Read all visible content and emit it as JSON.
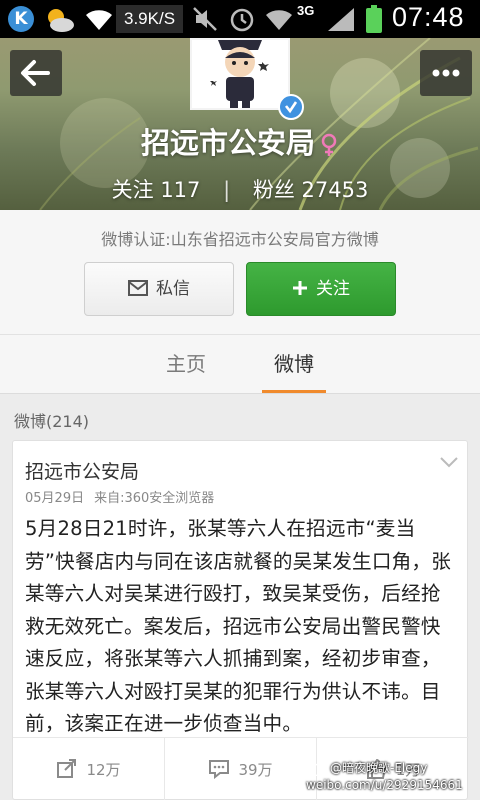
{
  "status_bar": {
    "net_speed": "3.9K/S",
    "network_type": "3G",
    "time": "07:48",
    "icons": [
      "k-app-icon",
      "weather-icon",
      "wifi-icon",
      "mute-icon",
      "alarm-icon",
      "wifi-icon",
      "signal-icon",
      "battery-icon"
    ]
  },
  "profile": {
    "name": "招远市公安局",
    "follow_label": "关注",
    "follow_count": "117",
    "fans_label": "粉丝",
    "fans_count": "27453",
    "verification": "微博认证:山东省招远市公安局官方微博"
  },
  "buttons": {
    "message_label": "私信",
    "follow_label": "关注"
  },
  "tabs": [
    {
      "label": "主页",
      "active": false
    },
    {
      "label": "微博",
      "active": true
    }
  ],
  "weibo_count_label": "微博(214)",
  "post": {
    "author": "招远市公安局",
    "date": "05月29日",
    "source": "来自:360安全浏览器",
    "content": "5月28日21时许，张某等六人在招远市“麦当劳”快餐店内与同在该店就餐的吴某发生口角，张某等六人对吴某进行殴打，致吴某受伤，后经抢救无效死亡。案发后，招远市公安局出警民警快速反应，将张某等六人抓捕到案，经初步审查，张某等六人对殴打吴某的犯罪行为供认不讳。目前，该案正在进一步侦查当中。",
    "repost_count": "12万",
    "comment_count": "39万",
    "like_count": "1万"
  },
  "watermark": {
    "line1": "@暗夜晚歌-Elegy",
    "line2": "weibo.com/u/2929154661"
  },
  "colors": {
    "follow_green": "#3aa83a",
    "tab_accent": "#f08a2c",
    "verified_blue": "#3f92e0"
  }
}
